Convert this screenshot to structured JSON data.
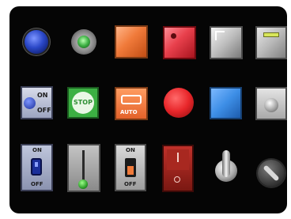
{
  "panel": {
    "title": "",
    "controls": [
      {
        "id": "blue-pilot-lamp",
        "icon": "blue-round-lamp-icon"
      },
      {
        "id": "green-indicator-light",
        "icon": "green-led-icon"
      },
      {
        "id": "orange-square-button",
        "icon": "orange-square-button-icon"
      },
      {
        "id": "red-square-button",
        "icon": "red-square-button-icon"
      },
      {
        "id": "gray-square-button",
        "icon": "gray-square-button-icon"
      },
      {
        "id": "gray-lamp-button",
        "icon": "gray-yellow-lamp-icon"
      },
      {
        "id": "on-off-switch",
        "icon": "on-off-switch-icon",
        "labels": {
          "on": "ON",
          "off": "OFF"
        }
      },
      {
        "id": "stop-button",
        "icon": "stop-icon",
        "label": "STOP"
      },
      {
        "id": "auto-button",
        "icon": "auto-arrow-icon",
        "label": "AUTO"
      },
      {
        "id": "red-round-button",
        "icon": "red-round-button-icon"
      },
      {
        "id": "blue-square-button",
        "icon": "blue-square-button-icon"
      },
      {
        "id": "gray-knob-button",
        "icon": "gray-knob-icon"
      },
      {
        "id": "blue-toggle-switch",
        "icon": "blue-toggle-icon",
        "labels": {
          "on": "ON",
          "off": "OFF"
        }
      },
      {
        "id": "vertical-slider",
        "icon": "slider-icon"
      },
      {
        "id": "orange-toggle-switch",
        "icon": "orange-toggle-icon",
        "labels": {
          "on": "ON",
          "off": "OFF"
        }
      },
      {
        "id": "red-rocker-switch",
        "icon": "rocker-switch-icon"
      },
      {
        "id": "toggle-lever-switch",
        "icon": "lever-switch-icon"
      },
      {
        "id": "rotary-selector-switch",
        "icon": "rotary-selector-icon"
      }
    ]
  },
  "colors": {
    "background": "#050505",
    "blue": "#2b48c8",
    "green": "#3cb043",
    "orange": "#f07a3a",
    "red": "#e8262a",
    "gray": "#b9b9b9",
    "yellow": "#d8e65a",
    "sky": "#3d8ee6"
  }
}
